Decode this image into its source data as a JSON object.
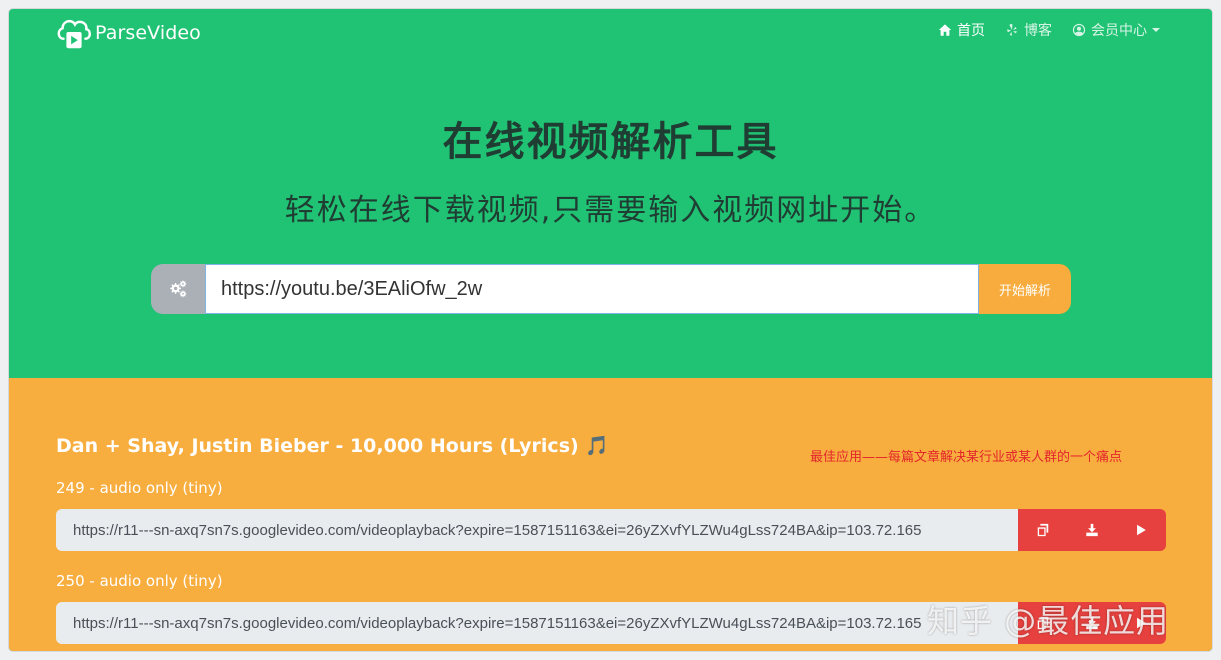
{
  "nav": {
    "brand": "ParseVideo",
    "links": [
      {
        "label": "首页",
        "icon": "home-icon",
        "active": true
      },
      {
        "label": "博客",
        "icon": "yelp-icon",
        "active": false
      },
      {
        "label": "会员中心",
        "icon": "user-circle-icon",
        "active": false
      }
    ]
  },
  "hero": {
    "title": "在线视频解析工具",
    "subtitle": "轻松在线下载视频,只需要输入视频网址开始。",
    "search_value": "https://youtu.be/3EAliOfw_2w",
    "search_button": "开始解析"
  },
  "result": {
    "video_title": "Dan + Shay, Justin Bieber - 10,000 Hours (Lyrics) 🎵",
    "formats": [
      {
        "label": "249 - audio only (tiny)",
        "url": "https://r11---sn-axq7sn7s.googlevideo.com/videoplayback?expire=1587151163&ei=26yZXvfYLZWu4gLss724BA&ip=103.72.165"
      },
      {
        "label": "250 - audio only (tiny)",
        "url": "https://r11---sn-axq7sn7s.googlevideo.com/videoplayback?expire=1587151163&ei=26yZXvfYLZWu4gLss724BA&ip=103.72.165"
      }
    ]
  },
  "watermarks": {
    "red_text": "最佳应用——每篇文章解决某行业或某人群的一个痛点",
    "zhihu": "知乎 @最佳应用"
  },
  "colors": {
    "hero_bg": "#20c374",
    "results_bg": "#f8ad3f",
    "button_orange": "#f7ac3d",
    "action_red": "#e6413e"
  }
}
